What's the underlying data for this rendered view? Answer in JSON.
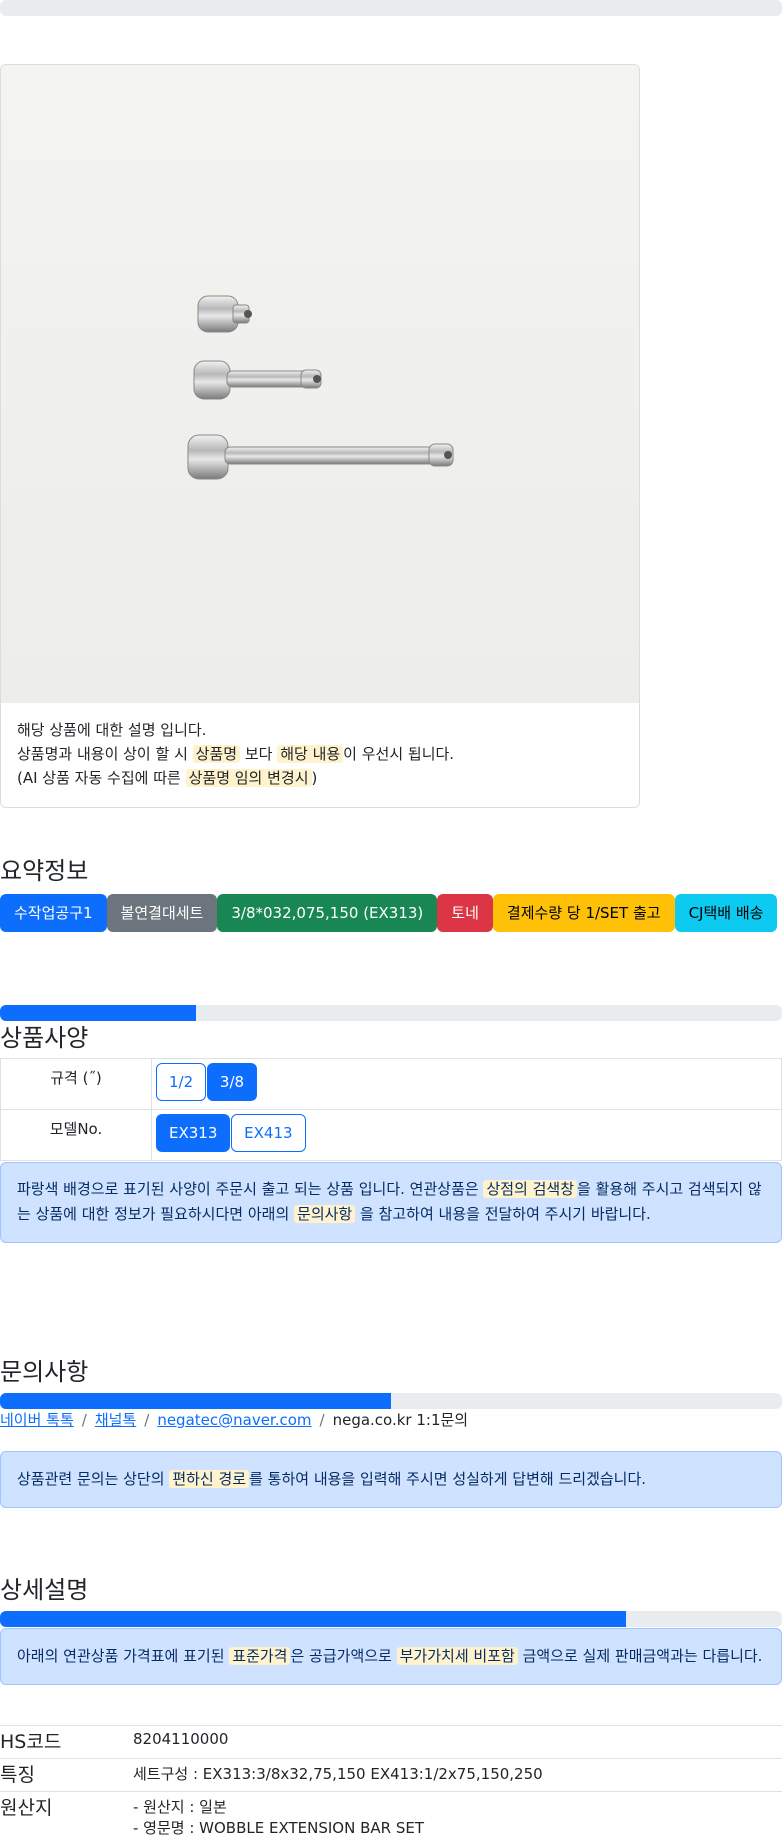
{
  "top_progress": {
    "value": 0
  },
  "product_image": {
    "description": "three chrome ratchet extension bars"
  },
  "card": {
    "line1": "해당 상품에 대한 설명 입니다.",
    "line2_a": "상품명과 내용이 상이 할 시 ",
    "line2_h1": "상품명",
    "line2_b": " 보다 ",
    "line2_h2": "해당 내용",
    "line2_c": "이 우선시 됩니다.",
    "line3_a": "(AI 상품 자동 수집에 따른 ",
    "line3_h": "상품명 임의 변경시",
    "line3_b": ")"
  },
  "summary": {
    "title": "요약정보",
    "badges": [
      {
        "label": "수작업공구1",
        "bg": "#0d6efd",
        "fg": "#ffffff"
      },
      {
        "label": "볼연결대세트",
        "bg": "#6c757d",
        "fg": "#ffffff"
      },
      {
        "label": "3/8*032,075,150 (EX313)",
        "bg": "#198754",
        "fg": "#ffffff"
      },
      {
        "label": "토네",
        "bg": "#dc3545",
        "fg": "#ffffff"
      },
      {
        "label": "결제수량 당 1/SET 출고",
        "bg": "#ffc107",
        "fg": "#000000"
      },
      {
        "label": "CJ택배 배송",
        "bg": "#0dcaf0",
        "fg": "#000000"
      }
    ]
  },
  "spec": {
    "progress": 0.25,
    "title": "상품사양",
    "rows": [
      {
        "label": "규격 (˝)",
        "options": [
          {
            "label": "1/2",
            "active": false
          },
          {
            "label": "3/8",
            "active": true
          }
        ]
      },
      {
        "label": "모델No.",
        "options": [
          {
            "label": "EX313",
            "active": true
          },
          {
            "label": "EX413",
            "active": false
          }
        ]
      }
    ],
    "alert_a": "파랑색 배경으로 표기된 사양이 주문시 출고 되는 상품 입니다. 연관상품은 ",
    "alert_h1": "상점의 검색창",
    "alert_b": "을 활용해 주시고 검색되지 않는 상품에 대한 정보가 필요하시다면 아래의 ",
    "alert_h2": "문의사항",
    "alert_c": " 을 참고하여 내용을 전달하여 주시기 바랍니다."
  },
  "inquiry": {
    "title": "문의사항",
    "progress": 0.5,
    "link1": "네이버 톡톡",
    "link2": "채널톡",
    "link3": "negatec@naver.com",
    "sep": "/",
    "text4": "nega.co.kr 1:1문의",
    "alert_a": "상품관련 문의는 상단의 ",
    "alert_h": "편하신 경로",
    "alert_b": "를 통하여 내용을 입력해 주시면 성실하게 답변해 드리겠습니다."
  },
  "detail": {
    "title": "상세설명",
    "progress": 0.8,
    "alert_a": "아래의 연관상품 가격표에 표기된 ",
    "alert_h1": "표준가격",
    "alert_b": "은 공급가액으로 ",
    "alert_h2": "부가가치세 비포함",
    "alert_c": " 금액으로 실제 판매금액과는 다릅니다.",
    "rows": [
      {
        "key": "HS코드",
        "value": "8204110000"
      },
      {
        "key": "특징",
        "value": "세트구성 : EX313:3/8x32,75,150 EX413:1/2x75,150,250"
      },
      {
        "key": "원산지",
        "value": "- 원산지 : 일본",
        "value2": "- 영문명 : WOBBLE EXTENSION BAR SET"
      }
    ]
  }
}
